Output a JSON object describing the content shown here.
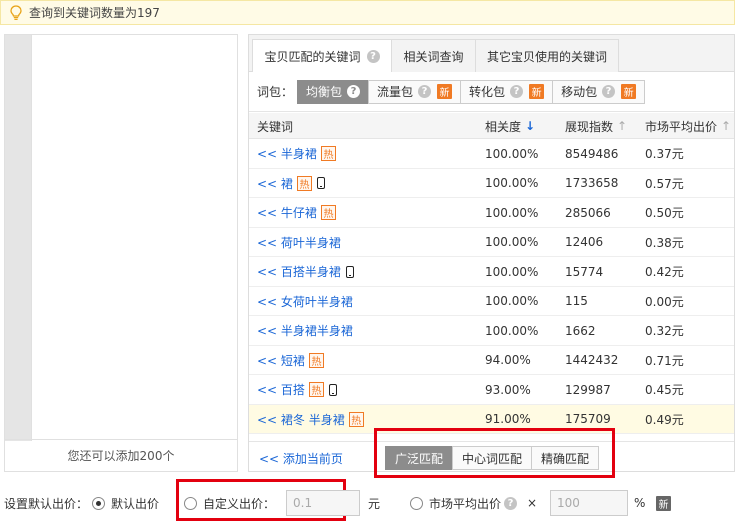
{
  "notice": {
    "text": "查询到关键词数量为197"
  },
  "left_panel": {
    "footer_text": "您还可以添加200个"
  },
  "tabs": [
    {
      "label": "宝贝匹配的关键词",
      "active": true,
      "has_help": true
    },
    {
      "label": "相关词查询",
      "active": false
    },
    {
      "label": "其它宝贝使用的关键词",
      "active": false
    }
  ],
  "packages": {
    "label": "词包：",
    "items": [
      {
        "label": "均衡包",
        "active": true,
        "help": true,
        "new": false
      },
      {
        "label": "流量包",
        "active": false,
        "help": true,
        "new": true
      },
      {
        "label": "转化包",
        "active": false,
        "help": true,
        "new": true
      },
      {
        "label": "移动包",
        "active": false,
        "help": true,
        "new": true
      }
    ],
    "new_badge_text": "新"
  },
  "table": {
    "headers": {
      "keyword": "关键词",
      "relevance": "相关度",
      "impressions": "展现指数",
      "avg_bid": "市场平均出价"
    },
    "hot_text": "热",
    "rows": [
      {
        "keyword": "<< 半身裙",
        "hot": true,
        "mobile": false,
        "relevance": "100.00%",
        "impressions": "8549486",
        "avg_bid": "0.37元"
      },
      {
        "keyword": "<< 裙",
        "hot": true,
        "mobile": true,
        "relevance": "100.00%",
        "impressions": "1733658",
        "avg_bid": "0.57元"
      },
      {
        "keyword": "<< 牛仔裙",
        "hot": true,
        "mobile": false,
        "relevance": "100.00%",
        "impressions": "285066",
        "avg_bid": "0.50元"
      },
      {
        "keyword": "<< 荷叶半身裙",
        "hot": false,
        "mobile": false,
        "relevance": "100.00%",
        "impressions": "12406",
        "avg_bid": "0.38元"
      },
      {
        "keyword": "<< 百搭半身裙",
        "hot": false,
        "mobile": true,
        "relevance": "100.00%",
        "impressions": "15774",
        "avg_bid": "0.42元"
      },
      {
        "keyword": "<< 女荷叶半身裙",
        "hot": false,
        "mobile": false,
        "relevance": "100.00%",
        "impressions": "115",
        "avg_bid": "0.00元"
      },
      {
        "keyword": "<< 半身裙半身裙",
        "hot": false,
        "mobile": false,
        "relevance": "100.00%",
        "impressions": "1662",
        "avg_bid": "0.32元"
      },
      {
        "keyword": "<< 短裙",
        "hot": true,
        "mobile": false,
        "relevance": "94.00%",
        "impressions": "1442432",
        "avg_bid": "0.71元"
      },
      {
        "keyword": "<< 百搭",
        "hot": true,
        "mobile": true,
        "relevance": "93.00%",
        "impressions": "129987",
        "avg_bid": "0.45元"
      },
      {
        "keyword": "<< 裙冬 半身裙",
        "hot": true,
        "mobile": false,
        "relevance": "91.00%",
        "impressions": "175709",
        "avg_bid": "0.49元",
        "highlight": true
      }
    ]
  },
  "bottom": {
    "add_page": "<<  添加当前页",
    "match_types": [
      {
        "label": "广泛匹配",
        "active": true
      },
      {
        "label": "中心词匹配",
        "active": false
      },
      {
        "label": "精确匹配",
        "active": false
      }
    ]
  },
  "bid": {
    "label": "设置默认出价：",
    "default_option": "默认出价",
    "custom_option": "自定义出价：",
    "custom_value": "0.1",
    "unit_yuan": "元",
    "market_option": "市场平均出价",
    "multiply": "×",
    "percent_value": "100",
    "unit_percent": "%",
    "new_badge": "新"
  },
  "colors": {
    "link": "#1a66d6",
    "hot": "#f07a24",
    "highlight_box": "#e3000f",
    "active_btn": "#8c8c8c"
  }
}
